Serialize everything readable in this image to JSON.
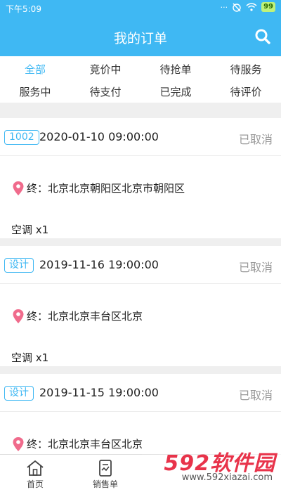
{
  "status_bar": {
    "time": "下午5:09",
    "battery": "99"
  },
  "header": {
    "title": "我的订单",
    "search_icon": "search-icon"
  },
  "tabs": [
    {
      "label": "全部",
      "active": true
    },
    {
      "label": "竞价中",
      "active": false
    },
    {
      "label": "待抢单",
      "active": false
    },
    {
      "label": "待服务",
      "active": false
    },
    {
      "label": "服务中",
      "active": false
    },
    {
      "label": "待支付",
      "active": false
    },
    {
      "label": "已完成",
      "active": false
    },
    {
      "label": "待评价",
      "active": false
    }
  ],
  "orders": [
    {
      "tag": "1002",
      "datetime": "2020-01-10 09:00:00",
      "status": "已取消",
      "address": "终：北京北京朝阳区北京市朝阳区",
      "item": "空调 x1"
    },
    {
      "tag": "设计",
      "datetime": "2019-11-16 19:00:00",
      "status": "已取消",
      "address": "终：北京北京丰台区北京",
      "item": "空调 x1"
    },
    {
      "tag": "设计",
      "datetime": "2019-11-15 19:00:00",
      "status": "已取消",
      "address": "终：北京北京丰台区北京",
      "item": ""
    }
  ],
  "bottom_nav": [
    {
      "label": "首页",
      "icon": "home-icon"
    },
    {
      "label": "销售单",
      "icon": "sales-order-icon"
    }
  ],
  "watermark": {
    "text": "592软件园",
    "url": "www.592xiazai.com"
  },
  "colors": {
    "accent": "#3fb8f3",
    "pin": "#f06b8c",
    "status_gray": "#999999"
  }
}
